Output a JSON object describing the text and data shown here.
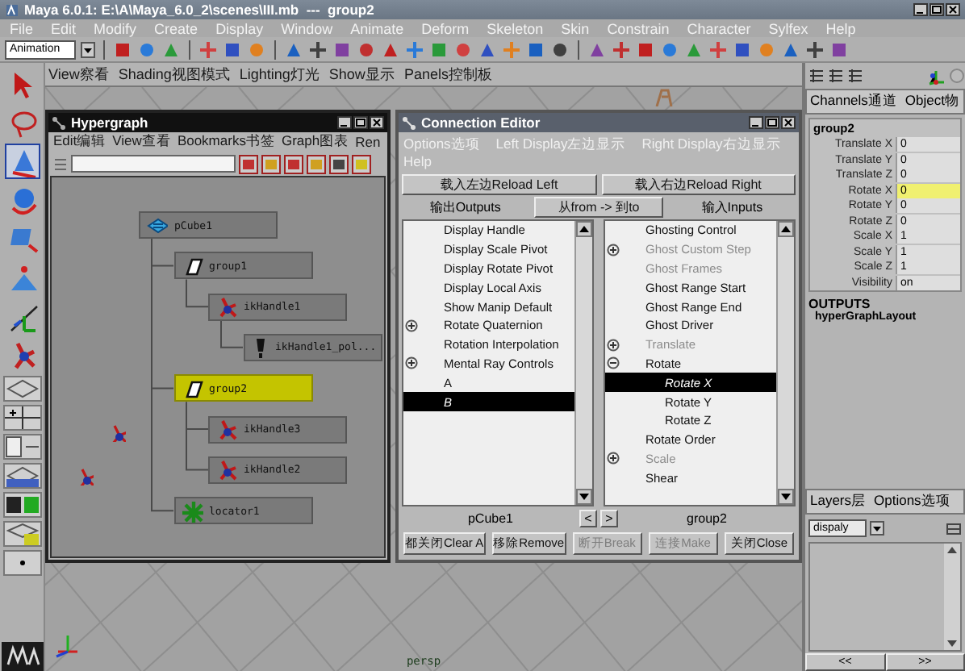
{
  "window": {
    "title": "Maya 6.0.1: E:\\A\\Maya_6.0_2\\scenes\\III.mb  ---  group2"
  },
  "menu": [
    "File",
    "Edit",
    "Modify",
    "Create",
    "Display",
    "Window",
    "Animate",
    "Deform",
    "Skeleton",
    "Skin",
    "Constrain",
    "Character",
    "Sylfex",
    "Help"
  ],
  "toolbar": {
    "mode_menu": "Animation"
  },
  "toolbox": {
    "tools": [
      {
        "kind": "select",
        "selected": false
      },
      {
        "kind": "lasso",
        "selected": false
      },
      {
        "kind": "paint",
        "selected": true
      },
      {
        "kind": "move",
        "selected": false
      },
      {
        "kind": "rotate",
        "selected": false
      },
      {
        "kind": "scale",
        "selected": false
      },
      {
        "kind": "manip",
        "selected": false
      },
      {
        "kind": "ik",
        "selected": false
      }
    ]
  },
  "panel_menu": [
    "View察看",
    "Shading视图模式",
    "Lighting灯光",
    "Show显示",
    "Panels控制板"
  ],
  "viewport": {
    "camera": "persp"
  },
  "hypergraph": {
    "title": "Hypergraph",
    "menu": [
      "Edit编辑",
      "View查看",
      "Bookmarks书签",
      "Graph图表",
      "Ren"
    ],
    "nodes": [
      {
        "label": "pCube1",
        "kind": "mesh",
        "selected": false,
        "children": [
          {
            "label": "group1",
            "kind": "transform",
            "selected": false,
            "children": [
              {
                "label": "ikHandle1",
                "kind": "ik",
                "selected": false,
                "children": [
                  {
                    "label": "ikHandle1_pol...",
                    "kind": "effector",
                    "selected": false
                  }
                ]
              }
            ]
          },
          {
            "label": "group2",
            "kind": "transform",
            "selected": true,
            "children": [
              {
                "label": "ikHandle3",
                "kind": "ik",
                "selected": false
              },
              {
                "label": "ikHandle2",
                "kind": "ik",
                "selected": false
              }
            ]
          },
          {
            "label": "locator1",
            "kind": "locator",
            "selected": false
          }
        ]
      }
    ]
  },
  "connection_editor": {
    "title": "Connection Editor",
    "menu": [
      "Options选项",
      "Left Display左边显示",
      "Right Display右边显示",
      "Help"
    ],
    "reload_left": "载入左边Reload Left",
    "reload_right": "载入右边Reload Right",
    "outputs": "输出Outputs",
    "from_to": "从from -> 到to",
    "inputs": "输入Inputs",
    "left_list": [
      {
        "label": "Display Handle",
        "selected": false
      },
      {
        "label": "Display Scale Pivot",
        "selected": false
      },
      {
        "label": "Display Rotate Pivot",
        "selected": false
      },
      {
        "label": "Display Local Axis",
        "selected": false
      },
      {
        "label": "Show Manip Default",
        "selected": false
      },
      {
        "label": "Rotate Quaternion",
        "selected": false,
        "expanded": false
      },
      {
        "label": "Rotation Interpolation",
        "selected": false
      },
      {
        "label": "Mental Ray Controls",
        "selected": false,
        "expanded": false
      },
      {
        "label": "A",
        "selected": false
      },
      {
        "label": "B",
        "selected": true
      }
    ],
    "right_list": [
      {
        "label": "Ghosting Control",
        "selected": false,
        "dimmed": false
      },
      {
        "label": "Ghost Custom Step",
        "selected": false,
        "dimmed": true,
        "expanded": false
      },
      {
        "label": "Ghost Frames",
        "selected": false,
        "dimmed": true
      },
      {
        "label": "Ghost Range Start",
        "selected": false,
        "dimmed": false
      },
      {
        "label": "Ghost Range End",
        "selected": false,
        "dimmed": false
      },
      {
        "label": "Ghost Driver",
        "selected": false,
        "dimmed": false
      },
      {
        "label": "Translate",
        "selected": false,
        "dimmed": true,
        "expanded": false
      },
      {
        "label": "Rotate",
        "selected": false,
        "dimmed": false,
        "expanded": true,
        "children": [
          {
            "label": "Rotate X",
            "selected": true,
            "dimmed": false
          },
          {
            "label": "Rotate Y",
            "selected": false,
            "dimmed": false
          },
          {
            "label": "Rotate Z",
            "selected": false,
            "dimmed": false
          }
        ]
      },
      {
        "label": "Rotate Order",
        "selected": false,
        "dimmed": false
      },
      {
        "label": "Scale",
        "selected": false,
        "dimmed": true,
        "expanded": false
      },
      {
        "label": "Shear",
        "selected": false,
        "dimmed": false
      }
    ],
    "left_node": "pCube1",
    "right_node": "group2",
    "nav": [
      "<",
      ">"
    ],
    "buttons": [
      {
        "label": "都关闭Clear A",
        "disabled": false
      },
      {
        "label": "移除Remove",
        "disabled": false
      },
      {
        "label": "断开Break",
        "disabled": true
      },
      {
        "label": "连接Make",
        "disabled": true
      },
      {
        "label": "关闭Close",
        "disabled": false
      }
    ]
  },
  "channel_box": {
    "tabs": [
      "Channels通道",
      "Object物"
    ],
    "node": "group2",
    "channels": [
      {
        "name": "Translate X",
        "value": "0",
        "selected": false
      },
      {
        "name": "Translate Y",
        "value": "0",
        "selected": false
      },
      {
        "name": "Translate Z",
        "value": "0",
        "selected": false
      },
      {
        "name": "Rotate X",
        "value": "0",
        "selected": true
      },
      {
        "name": "Rotate Y",
        "value": "0",
        "selected": false
      },
      {
        "name": "Rotate Z",
        "value": "0",
        "selected": false
      },
      {
        "name": "Scale X",
        "value": "1",
        "selected": false
      },
      {
        "name": "Scale Y",
        "value": "1",
        "selected": false
      },
      {
        "name": "Scale Z",
        "value": "1",
        "selected": false
      },
      {
        "name": "Visibility",
        "value": "on",
        "selected": false
      }
    ],
    "outputs_heading": "OUTPUTS",
    "outputs": [
      "hyperGraphLayout"
    ]
  },
  "layers": {
    "menu": [
      "Layers层",
      "Options选项"
    ],
    "display_menu": "dispaly",
    "nav": [
      "<<",
      ">>"
    ]
  }
}
